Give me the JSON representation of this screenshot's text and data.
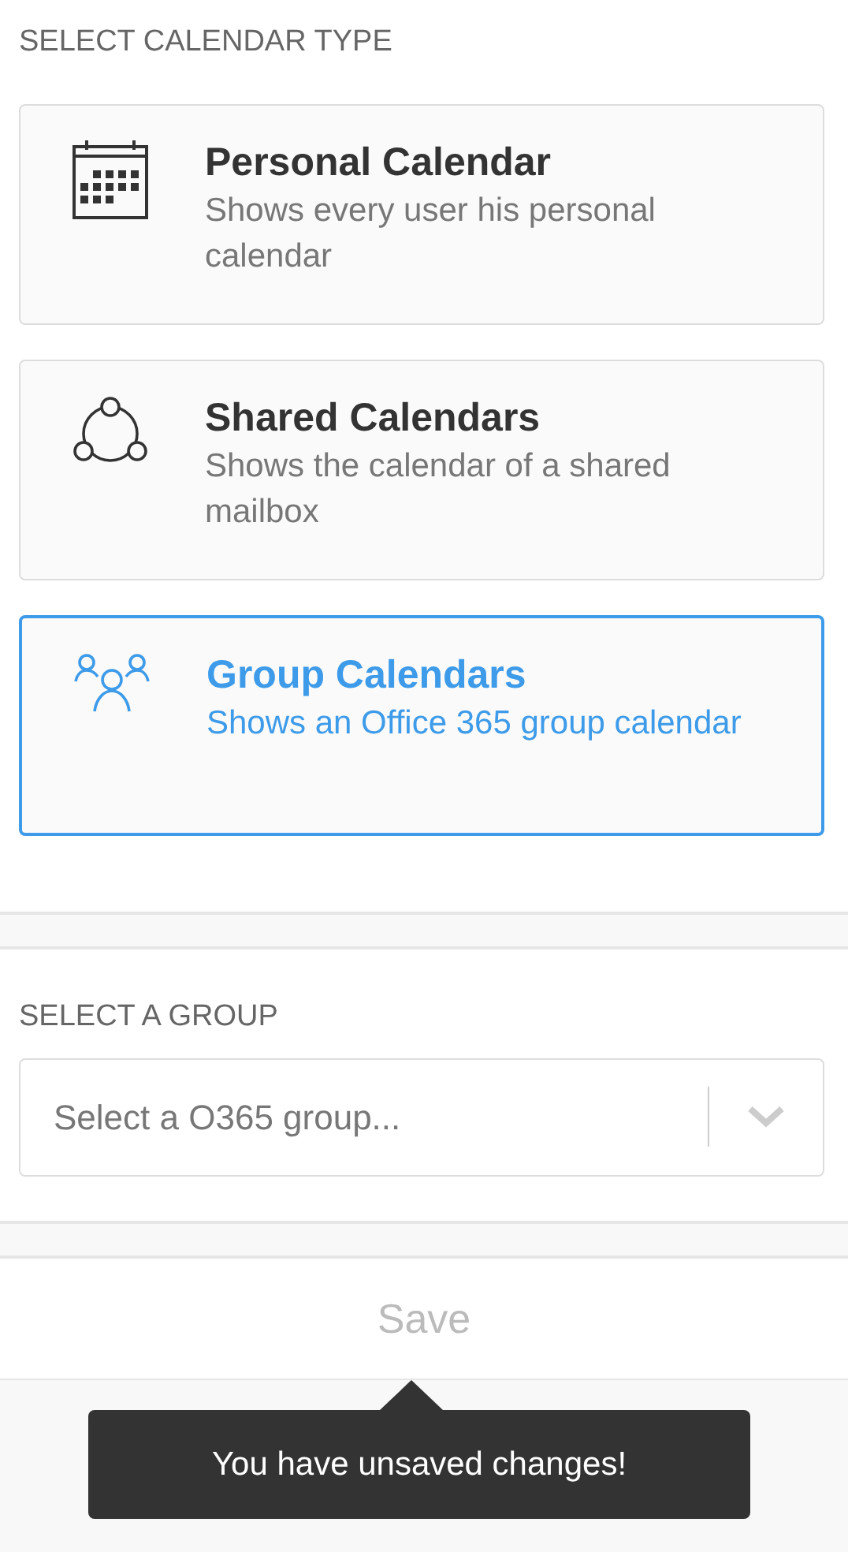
{
  "calendar_type": {
    "heading": "SELECT CALENDAR TYPE",
    "options": [
      {
        "kind": "calendar",
        "title": "Personal Calendar",
        "description": "Shows every user his personal calendar",
        "selected": false
      },
      {
        "kind": "shared",
        "title": "Shared Calendars",
        "description": "Shows the calendar of a shared mailbox",
        "selected": false
      },
      {
        "kind": "group",
        "title": "Group Calendars",
        "description": "Shows an Office 365 group calendar",
        "selected": true
      }
    ]
  },
  "group": {
    "heading": "SELECT A GROUP",
    "placeholder": "Select a O365 group..."
  },
  "save_button": {
    "label": "Save",
    "disabled": true
  },
  "tooltip": "You have unsaved changes!"
}
